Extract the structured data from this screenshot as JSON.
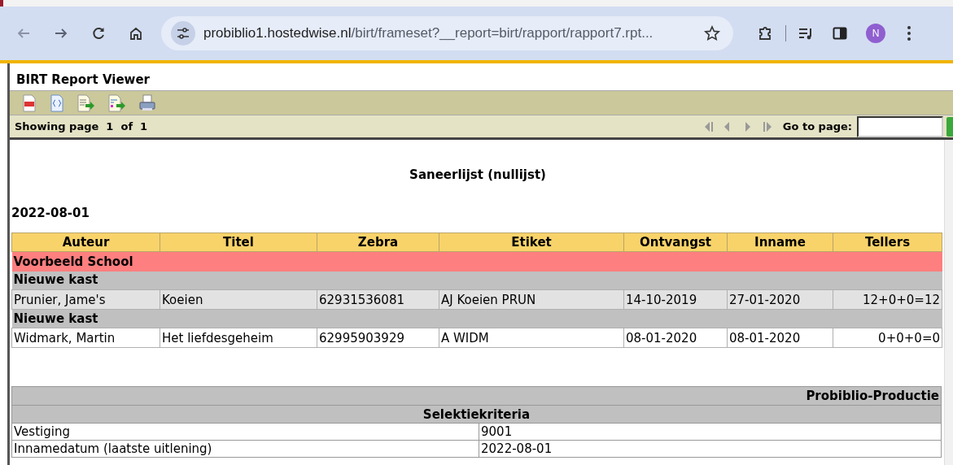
{
  "browser": {
    "url_host": "probiblio1.hostedwise.nl",
    "url_path": "/birt/frameset?__report=birt/rapport/rapport7.rpt...",
    "profile_initial": "N"
  },
  "viewer": {
    "title": "BIRT Report Viewer",
    "page_status": "Showing page  1  of  1",
    "goto_label": "Go to page:"
  },
  "report": {
    "title": "Saneerlijst (nullijst)",
    "date": "2022-08-01",
    "columns": [
      "Auteur",
      "Titel",
      "Zebra",
      "Etiket",
      "Ontvangst",
      "Inname",
      "Tellers"
    ],
    "rows": [
      {
        "kind": "branch",
        "label": "Voorbeeld School"
      },
      {
        "kind": "group",
        "label": "Nieuwe kast"
      },
      {
        "kind": "item",
        "shaded": true,
        "cells": [
          "Prunier, Jame's",
          "Koeien",
          "62931536081",
          "AJ Koeien PRUN",
          "14-10-2019",
          "27-01-2020",
          "12+0+0=12"
        ]
      },
      {
        "kind": "group",
        "label": "Nieuwe kast"
      },
      {
        "kind": "item",
        "shaded": false,
        "cells": [
          "Widmark, Martin",
          "Het liefdesgeheim",
          "62995903929",
          "A WIDM",
          "08-01-2020",
          "08-01-2020",
          "0+0+0=0"
        ]
      }
    ],
    "footer": {
      "organization": "Probiblio-Productie",
      "criteria_title": "Selektiekriteria",
      "criteria": [
        {
          "label": "Vestiging",
          "value": "9001"
        },
        {
          "label": "Innamedatum (laatste uitlening)",
          "value": "2022-08-01"
        }
      ]
    }
  }
}
